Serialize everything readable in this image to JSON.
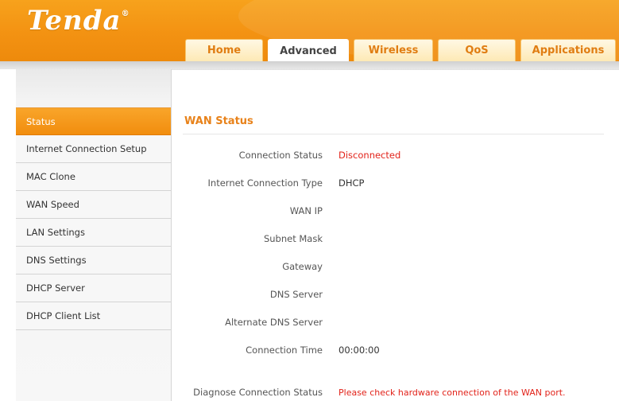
{
  "header": {
    "logo_text": "Tenda",
    "logo_mark": "®",
    "tabs": [
      {
        "label": "Home",
        "active": false
      },
      {
        "label": "Advanced",
        "active": true
      },
      {
        "label": "Wireless",
        "active": false
      },
      {
        "label": "QoS",
        "active": false
      },
      {
        "label": "Applications",
        "active": false
      }
    ]
  },
  "sidebar": {
    "items": [
      {
        "label": "Status",
        "active": true
      },
      {
        "label": "Internet Connection Setup",
        "active": false
      },
      {
        "label": "MAC Clone",
        "active": false
      },
      {
        "label": "WAN Speed",
        "active": false
      },
      {
        "label": "LAN Settings",
        "active": false
      },
      {
        "label": "DNS Settings",
        "active": false
      },
      {
        "label": "DHCP Server",
        "active": false
      },
      {
        "label": "DHCP Client List",
        "active": false
      }
    ]
  },
  "main": {
    "section_title": "WAN Status",
    "rows": [
      {
        "label": "Connection Status",
        "value": "Disconnected",
        "highlight": true
      },
      {
        "label": "Internet Connection Type",
        "value": "DHCP",
        "highlight": false
      },
      {
        "label": "WAN IP",
        "value": "",
        "highlight": false
      },
      {
        "label": "Subnet Mask",
        "value": "",
        "highlight": false
      },
      {
        "label": "Gateway",
        "value": "",
        "highlight": false
      },
      {
        "label": "DNS Server",
        "value": "",
        "highlight": false
      },
      {
        "label": "Alternate DNS Server",
        "value": "",
        "highlight": false
      },
      {
        "label": "Connection Time",
        "value": "00:00:00",
        "highlight": false
      },
      {
        "label": "Diagnose Connection Status",
        "value": "Please check hardware connection of the WAN port.",
        "highlight": true
      }
    ]
  },
  "colors": {
    "brand_orange": "#f39212",
    "title_orange": "#e8821a",
    "alert_red": "#e2231a"
  }
}
